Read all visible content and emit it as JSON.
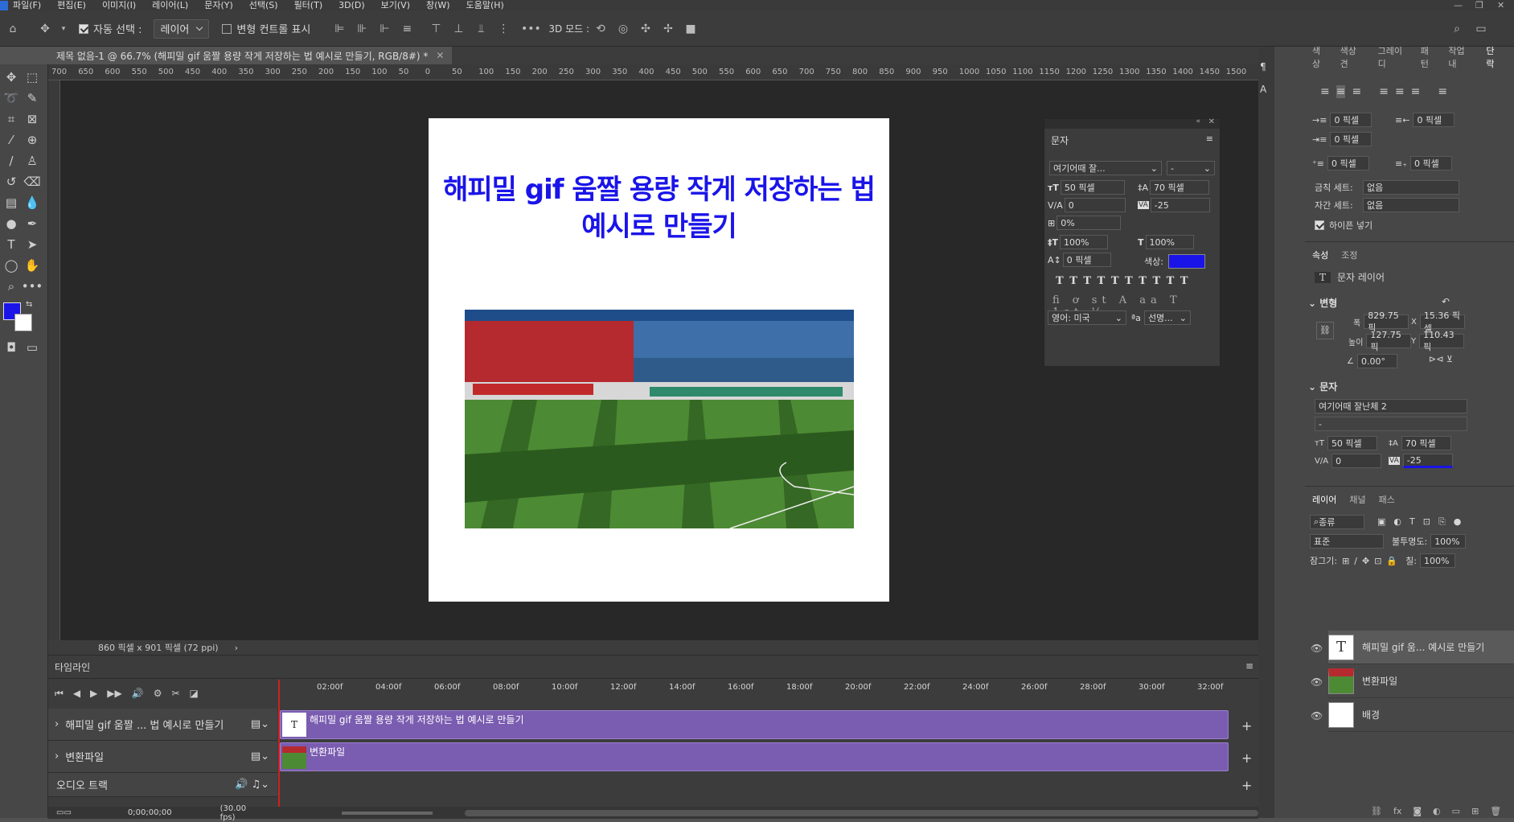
{
  "menu": [
    "파일(F)",
    "편집(E)",
    "이미지(I)",
    "레이어(L)",
    "문자(Y)",
    "선택(S)",
    "필터(T)",
    "3D(D)",
    "보기(V)",
    "창(W)",
    "도움말(H)"
  ],
  "options": {
    "auto_select": "자동 선택 :",
    "layer_select": "레이어",
    "transform_controls": "변형 컨트롤 표시",
    "mode_3d": "3D 모드 :"
  },
  "document": {
    "tab_title": "제목 없음-1 @ 66.7% (해피밀 gif 움짤 용량 작게 저장하는 법 예시로 만들기, RGB/8#) *",
    "canvas_title_line1": "해피밀 gif 움짤 용량 작게 저장하는 법",
    "canvas_title_line2": "예시로 만들기",
    "status": "860 픽셀 x 901 픽셀 (72 ppi)"
  },
  "ruler": [
    "700",
    "650",
    "600",
    "550",
    "500",
    "450",
    "400",
    "350",
    "300",
    "250",
    "200",
    "150",
    "100",
    "50",
    "0",
    "50",
    "100",
    "150",
    "200",
    "250",
    "300",
    "350",
    "400",
    "450",
    "500",
    "550",
    "600",
    "650",
    "700",
    "750",
    "800",
    "850",
    "900",
    "950",
    "1000",
    "1050",
    "1100",
    "1150",
    "1200",
    "1250",
    "1300",
    "1350",
    "1400",
    "1450",
    "1500"
  ],
  "char_panel": {
    "title": "문자",
    "font": "여기어때 잘...",
    "style": "-",
    "size": "50 픽셀",
    "leading": "70 픽셀",
    "kerning": "0",
    "tracking": "-25",
    "scale_pct": "0%",
    "vscale": "100%",
    "hscale": "100%",
    "baseline": "0 픽셀",
    "color_label": "색상:",
    "language": "영어: 미국",
    "aa_label": "ªa",
    "aa": "선명...",
    "color": "#1a14e8"
  },
  "timeline": {
    "title": "타임라인",
    "time": "0;00;00;00",
    "fps": "(30.00 fps)",
    "marks": [
      "02:00f",
      "04:00f",
      "06:00f",
      "08:00f",
      "10:00f",
      "12:00f",
      "14:00f",
      "16:00f",
      "18:00f",
      "20:00f",
      "22:00f",
      "24:00f",
      "26:00f",
      "28:00f",
      "30:00f",
      "32:00f"
    ],
    "tracks": [
      {
        "name": "해피밀 gif 움짤 ... 법 예시로 만들기",
        "clip": "해피밀 gif 움짤 용량 작게 저장하는 법 예시로 만들기"
      },
      {
        "name": "변환파일",
        "clip": "변환파일"
      }
    ],
    "audio": "오디오 트랙"
  },
  "right": {
    "tabs1": [
      "색상",
      "색상 견",
      "그레이디",
      "패턴",
      "작업 내",
      "단락"
    ],
    "para": {
      "indent_left": "0 픽셀",
      "indent_right": "0 픽셀",
      "indent_first": "0 픽셀",
      "space_before": "0 픽셀",
      "space_after": "0 픽셀",
      "kinsoku_label": "금칙 세트:",
      "kinsoku": "없음",
      "mojikumi_label": "자간 세트:",
      "mojikumi": "없음",
      "hyphenate": "하이픈 넣기"
    },
    "props_tabs": [
      "속성",
      "조정"
    ],
    "props_type": "문자 레이어",
    "transform_label": "변형",
    "w_label": "폭",
    "w": "829.75 픽",
    "x_label": "X",
    "x": "15.36 픽셀",
    "h_label": "높이",
    "h": "127.75 픽",
    "y_label": "Y",
    "y": "110.43 픽",
    "angle": "0.00°",
    "type_label": "문자",
    "font": "여기어때 잘난체 2",
    "style": "-",
    "size": "50 픽셀",
    "leading": "70 픽셀",
    "kerning": "0",
    "tracking": "-25",
    "layers_tabs": [
      "레이어",
      "채널",
      "패스"
    ],
    "kind": "종류",
    "blend": "표준",
    "opacity_label": "불투명도:",
    "opacity": "100%",
    "lock_label": "잠그기:",
    "fill_label": "칠:",
    "fill": "100%",
    "layers": [
      {
        "name": "해피밀 gif 움... 예시로 만들기"
      },
      {
        "name": "변환파일"
      },
      {
        "name": "배경"
      }
    ]
  }
}
